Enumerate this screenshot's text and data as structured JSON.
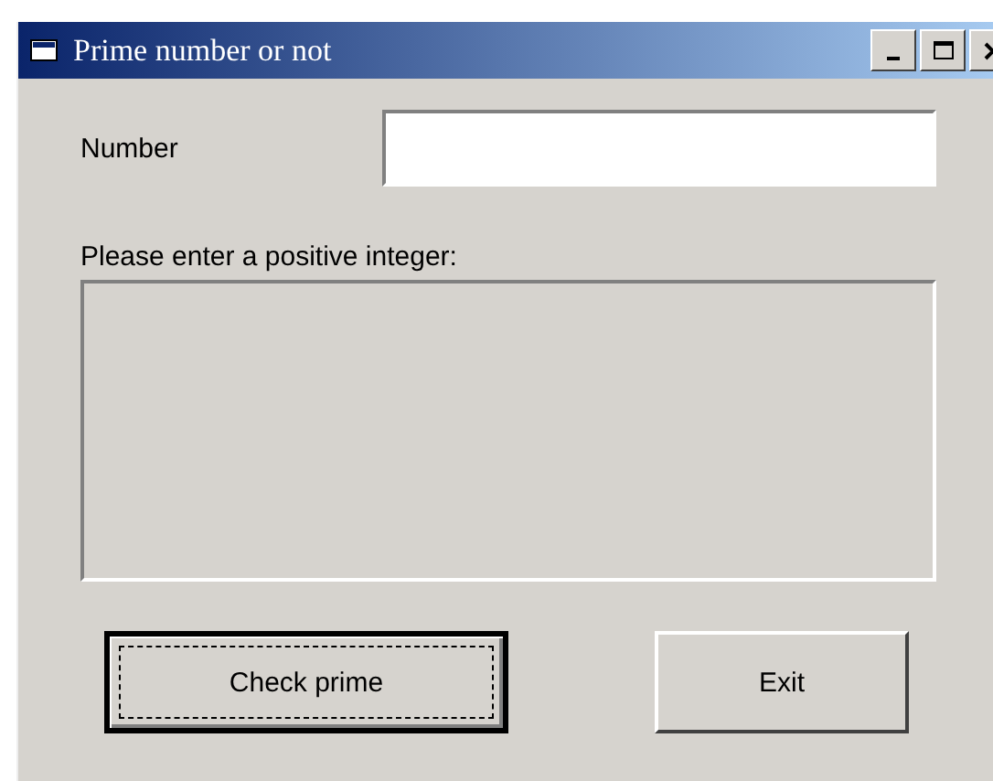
{
  "window": {
    "title": "Prime number or not"
  },
  "number_label": "Number",
  "prompt": "Please enter a positive integer:",
  "buttons": [
    {
      "label": "Check prime",
      "focused": true
    },
    {
      "label": "Exit",
      "focused": false
    }
  ]
}
